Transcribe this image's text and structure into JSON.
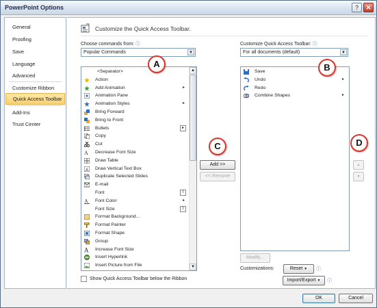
{
  "window": {
    "title": "PowerPoint Options",
    "help_glyph": "?",
    "close_glyph": "✕"
  },
  "nav": {
    "items": [
      {
        "label": "General"
      },
      {
        "label": "Proofing"
      },
      {
        "label": "Save"
      },
      {
        "label": "Language"
      },
      {
        "label": "Advanced"
      },
      {
        "label": "Customize Ribbon"
      },
      {
        "label": "Quick Access Toolbar",
        "selected": true
      },
      {
        "label": "Add-Ins"
      },
      {
        "label": "Trust Center"
      }
    ]
  },
  "header": {
    "title": "Customize the Quick Access Toolbar."
  },
  "choose_commands": {
    "label": "Choose commands from:",
    "info_glyph": "ⓘ",
    "value": "Popular Commands"
  },
  "customize_toolbar": {
    "label": "Customize Quick Access Toolbar:",
    "info_glyph": "ⓘ",
    "value": "For all documents (default)"
  },
  "commands": [
    {
      "label": "<Separator>",
      "icon": "separator"
    },
    {
      "label": "Action",
      "icon": "action-star-icon"
    },
    {
      "label": "Add Animation",
      "icon": "add-animation-icon",
      "submenu": "▸"
    },
    {
      "label": "Animation Pane",
      "icon": "animation-pane-icon"
    },
    {
      "label": "Animation Styles",
      "icon": "animation-styles-icon",
      "submenu": "▸"
    },
    {
      "label": "Bring Forward",
      "icon": "bring-forward-icon"
    },
    {
      "label": "Bring to Front",
      "icon": "bring-to-front-icon"
    },
    {
      "label": "Bullets",
      "icon": "bullets-icon",
      "subbox": "▸"
    },
    {
      "label": "Copy",
      "icon": "copy-icon"
    },
    {
      "label": "Cut",
      "icon": "cut-icon"
    },
    {
      "label": "Decrease Font Size",
      "icon": "decrease-font-icon"
    },
    {
      "label": "Draw Table",
      "icon": "draw-table-icon"
    },
    {
      "label": "Draw Vertical Text Box",
      "icon": "vertical-textbox-icon"
    },
    {
      "label": "Duplicate Selected Slides",
      "icon": "duplicate-slides-icon"
    },
    {
      "label": "E-mail",
      "icon": "email-icon"
    },
    {
      "label": "Font",
      "icon": "none",
      "subbox": "I"
    },
    {
      "label": "Font Color",
      "icon": "font-color-icon",
      "submenu": "▸"
    },
    {
      "label": "Font Size",
      "icon": "none",
      "subbox": "I"
    },
    {
      "label": "Format Background...",
      "icon": "format-background-icon"
    },
    {
      "label": "Format Painter",
      "icon": "format-painter-icon"
    },
    {
      "label": "Format Shape",
      "icon": "format-shape-icon"
    },
    {
      "label": "Group",
      "icon": "group-icon"
    },
    {
      "label": "Increase Font Size",
      "icon": "increase-font-icon"
    },
    {
      "label": "Insert Hyperlink",
      "icon": "hyperlink-icon"
    },
    {
      "label": "Insert Picture from File",
      "icon": "insert-picture-icon"
    }
  ],
  "toolbar_items": [
    {
      "label": "Save",
      "icon": "save-icon"
    },
    {
      "label": "Undo",
      "icon": "undo-icon",
      "submenu": "▸"
    },
    {
      "label": "Redo",
      "icon": "redo-icon"
    },
    {
      "label": "Combine Shapes",
      "icon": "combine-shapes-icon",
      "submenu": "▸"
    }
  ],
  "buttons": {
    "add": "Add >>",
    "remove": "<< Remove",
    "modify": "Modify...",
    "reset": "Reset",
    "import_export": "Import/Export",
    "ok": "OK",
    "cancel": "Cancel",
    "move_up": "▲",
    "move_down": "▼"
  },
  "customizations": {
    "label": "Customizations:"
  },
  "show_below": {
    "label": "Show Quick Access Toolbar below the Ribbon",
    "checked": false
  },
  "callouts": {
    "a": "A",
    "b": "B",
    "c": "C",
    "d": "D"
  },
  "colors": {
    "accent": "#d9342b",
    "selection": "#f8d070",
    "icon_blue": "#2f6dbf"
  }
}
